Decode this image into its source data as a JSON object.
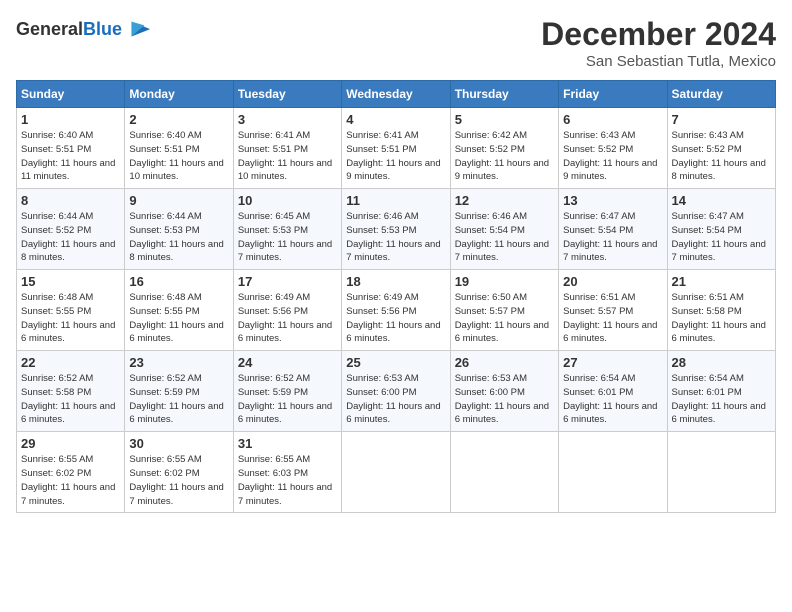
{
  "logo": {
    "general": "General",
    "blue": "Blue"
  },
  "title": "December 2024",
  "location": "San Sebastian Tutla, Mexico",
  "days_header": [
    "Sunday",
    "Monday",
    "Tuesday",
    "Wednesday",
    "Thursday",
    "Friday",
    "Saturday"
  ],
  "weeks": [
    [
      {
        "day": "1",
        "sunrise": "6:40 AM",
        "sunset": "5:51 PM",
        "daylight": "11 hours and 11 minutes."
      },
      {
        "day": "2",
        "sunrise": "6:40 AM",
        "sunset": "5:51 PM",
        "daylight": "11 hours and 10 minutes."
      },
      {
        "day": "3",
        "sunrise": "6:41 AM",
        "sunset": "5:51 PM",
        "daylight": "11 hours and 10 minutes."
      },
      {
        "day": "4",
        "sunrise": "6:41 AM",
        "sunset": "5:51 PM",
        "daylight": "11 hours and 9 minutes."
      },
      {
        "day": "5",
        "sunrise": "6:42 AM",
        "sunset": "5:52 PM",
        "daylight": "11 hours and 9 minutes."
      },
      {
        "day": "6",
        "sunrise": "6:43 AM",
        "sunset": "5:52 PM",
        "daylight": "11 hours and 9 minutes."
      },
      {
        "day": "7",
        "sunrise": "6:43 AM",
        "sunset": "5:52 PM",
        "daylight": "11 hours and 8 minutes."
      }
    ],
    [
      {
        "day": "8",
        "sunrise": "6:44 AM",
        "sunset": "5:52 PM",
        "daylight": "11 hours and 8 minutes."
      },
      {
        "day": "9",
        "sunrise": "6:44 AM",
        "sunset": "5:53 PM",
        "daylight": "11 hours and 8 minutes."
      },
      {
        "day": "10",
        "sunrise": "6:45 AM",
        "sunset": "5:53 PM",
        "daylight": "11 hours and 7 minutes."
      },
      {
        "day": "11",
        "sunrise": "6:46 AM",
        "sunset": "5:53 PM",
        "daylight": "11 hours and 7 minutes."
      },
      {
        "day": "12",
        "sunrise": "6:46 AM",
        "sunset": "5:54 PM",
        "daylight": "11 hours and 7 minutes."
      },
      {
        "day": "13",
        "sunrise": "6:47 AM",
        "sunset": "5:54 PM",
        "daylight": "11 hours and 7 minutes."
      },
      {
        "day": "14",
        "sunrise": "6:47 AM",
        "sunset": "5:54 PM",
        "daylight": "11 hours and 7 minutes."
      }
    ],
    [
      {
        "day": "15",
        "sunrise": "6:48 AM",
        "sunset": "5:55 PM",
        "daylight": "11 hours and 6 minutes."
      },
      {
        "day": "16",
        "sunrise": "6:48 AM",
        "sunset": "5:55 PM",
        "daylight": "11 hours and 6 minutes."
      },
      {
        "day": "17",
        "sunrise": "6:49 AM",
        "sunset": "5:56 PM",
        "daylight": "11 hours and 6 minutes."
      },
      {
        "day": "18",
        "sunrise": "6:49 AM",
        "sunset": "5:56 PM",
        "daylight": "11 hours and 6 minutes."
      },
      {
        "day": "19",
        "sunrise": "6:50 AM",
        "sunset": "5:57 PM",
        "daylight": "11 hours and 6 minutes."
      },
      {
        "day": "20",
        "sunrise": "6:51 AM",
        "sunset": "5:57 PM",
        "daylight": "11 hours and 6 minutes."
      },
      {
        "day": "21",
        "sunrise": "6:51 AM",
        "sunset": "5:58 PM",
        "daylight": "11 hours and 6 minutes."
      }
    ],
    [
      {
        "day": "22",
        "sunrise": "6:52 AM",
        "sunset": "5:58 PM",
        "daylight": "11 hours and 6 minutes."
      },
      {
        "day": "23",
        "sunrise": "6:52 AM",
        "sunset": "5:59 PM",
        "daylight": "11 hours and 6 minutes."
      },
      {
        "day": "24",
        "sunrise": "6:52 AM",
        "sunset": "5:59 PM",
        "daylight": "11 hours and 6 minutes."
      },
      {
        "day": "25",
        "sunrise": "6:53 AM",
        "sunset": "6:00 PM",
        "daylight": "11 hours and 6 minutes."
      },
      {
        "day": "26",
        "sunrise": "6:53 AM",
        "sunset": "6:00 PM",
        "daylight": "11 hours and 6 minutes."
      },
      {
        "day": "27",
        "sunrise": "6:54 AM",
        "sunset": "6:01 PM",
        "daylight": "11 hours and 6 minutes."
      },
      {
        "day": "28",
        "sunrise": "6:54 AM",
        "sunset": "6:01 PM",
        "daylight": "11 hours and 6 minutes."
      }
    ],
    [
      {
        "day": "29",
        "sunrise": "6:55 AM",
        "sunset": "6:02 PM",
        "daylight": "11 hours and 7 minutes."
      },
      {
        "day": "30",
        "sunrise": "6:55 AM",
        "sunset": "6:02 PM",
        "daylight": "11 hours and 7 minutes."
      },
      {
        "day": "31",
        "sunrise": "6:55 AM",
        "sunset": "6:03 PM",
        "daylight": "11 hours and 7 minutes."
      },
      null,
      null,
      null,
      null
    ]
  ]
}
